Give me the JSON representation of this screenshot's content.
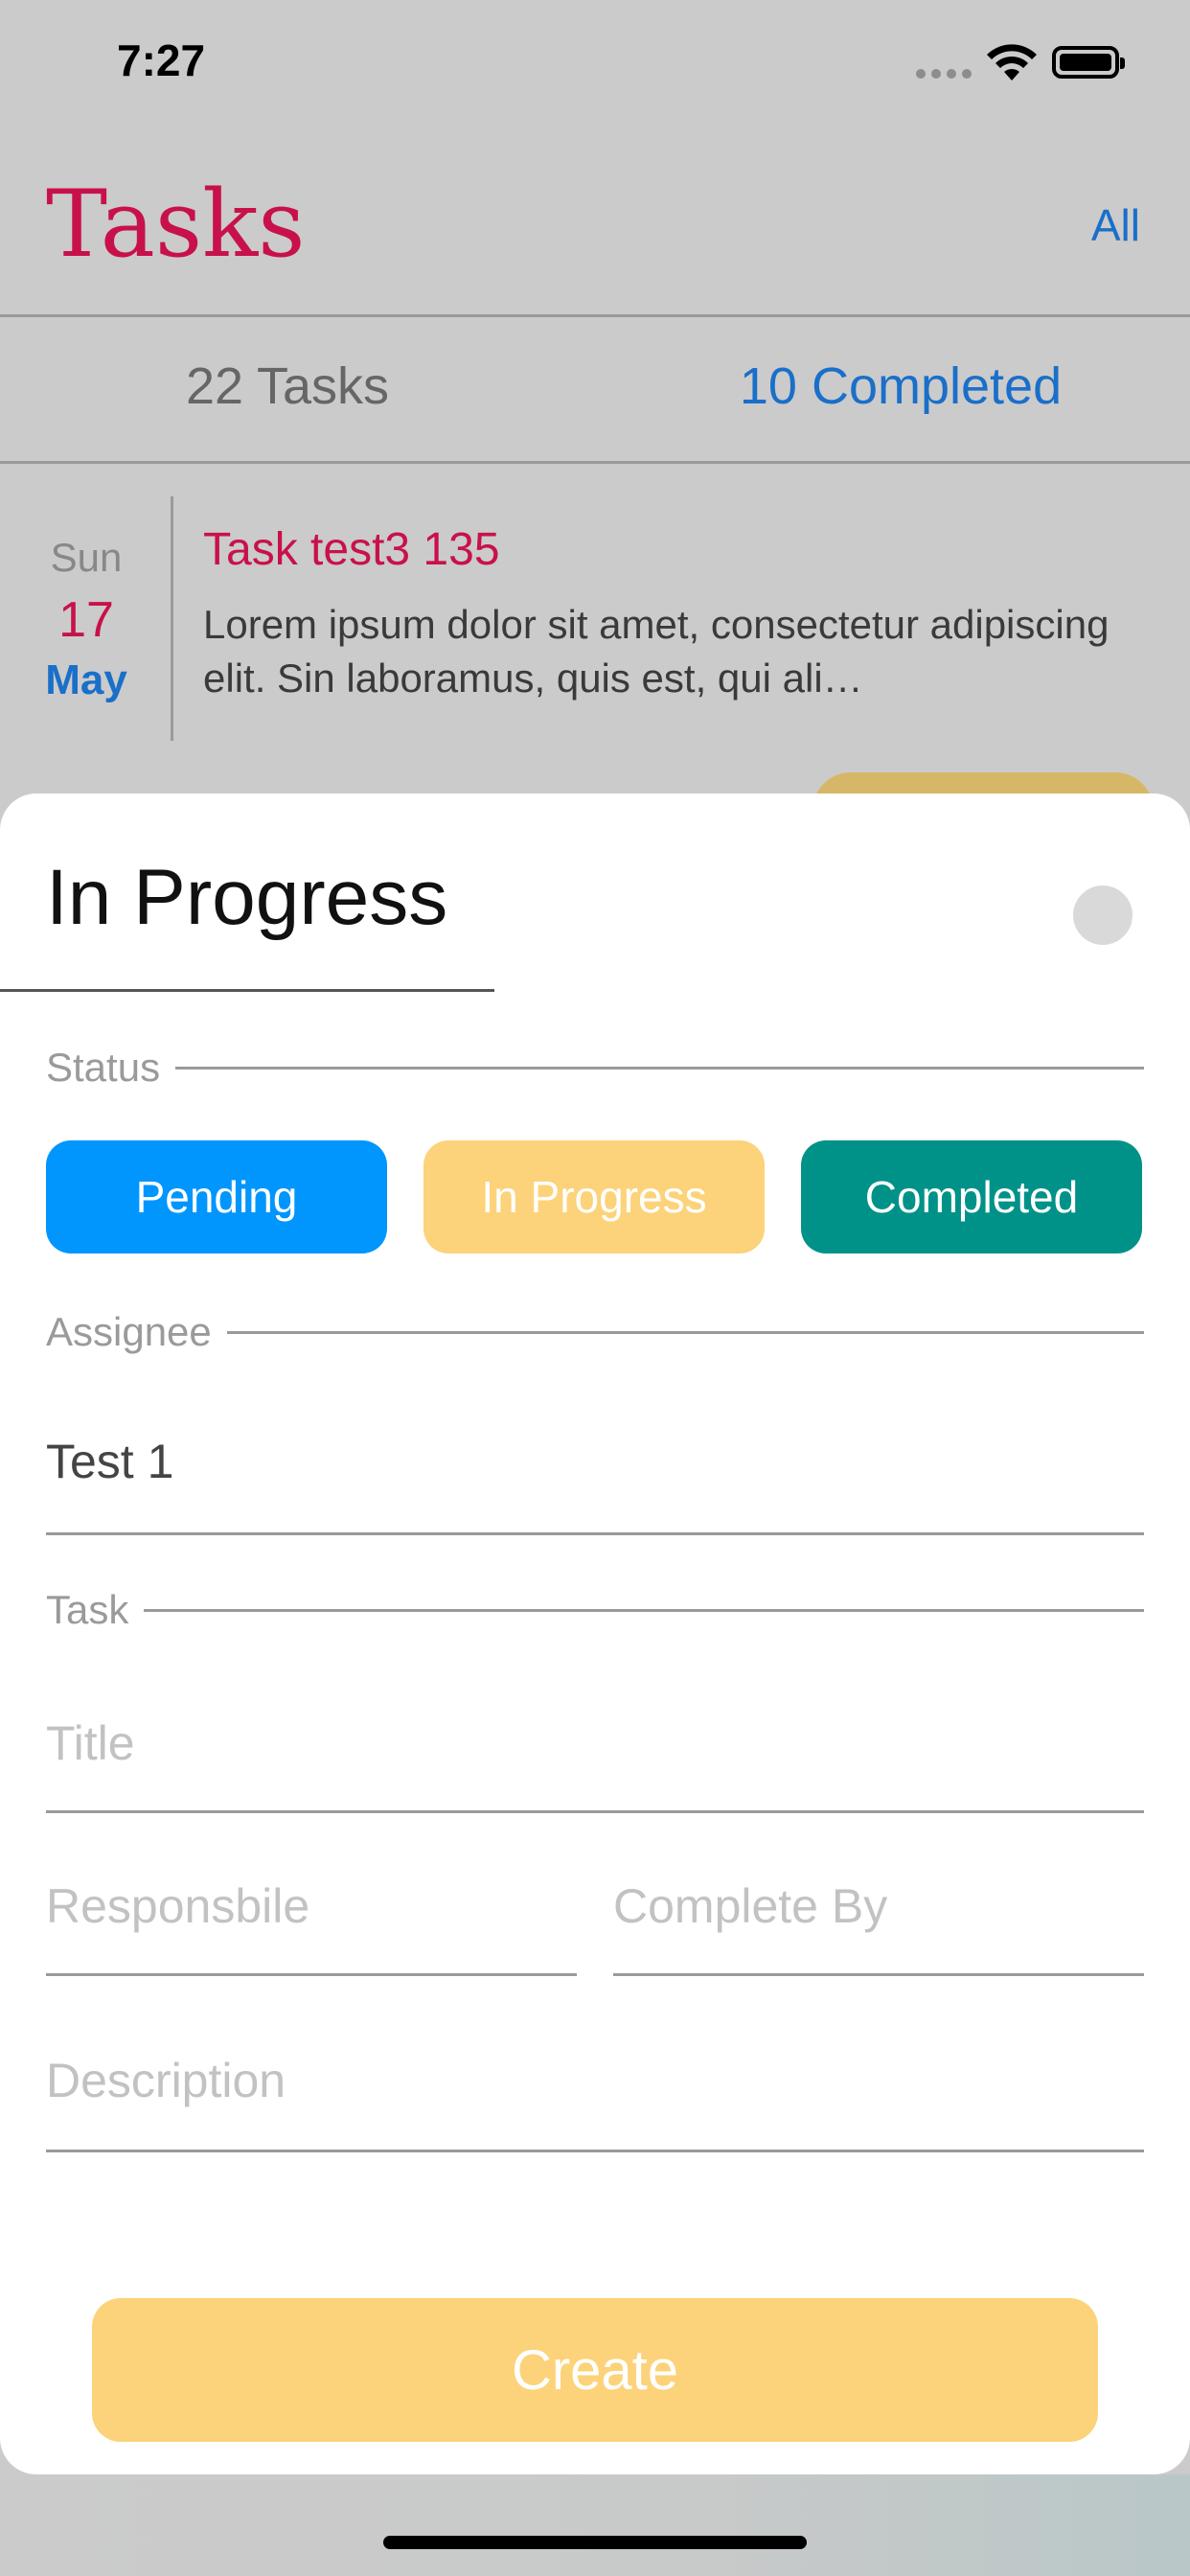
{
  "status_bar": {
    "time": "7:27"
  },
  "header": {
    "title": "Tasks",
    "filter_label": "All"
  },
  "summary": {
    "total": "22 Tasks",
    "completed": "10 Completed"
  },
  "task": {
    "day": "Sun",
    "date": "17",
    "month": "May",
    "title": "Task test3 135",
    "description": "Lorem ipsum dolor sit amet, consectetur adipiscing elit. Sin laboramus, quis est, qui ali…"
  },
  "sheet": {
    "title": "In Progress",
    "status_label": "Status",
    "status_options": [
      "Pending",
      "In Progress",
      "Completed"
    ],
    "assignee_label": "Assignee",
    "assignee_value": "Test 1",
    "task_label": "Task",
    "title_placeholder": "Title",
    "responsible_placeholder": "Responsbile",
    "complete_by_placeholder": "Complete By",
    "description_placeholder": "Description",
    "create_label": "Create"
  },
  "colors": {
    "accent_red": "#c8114a",
    "accent_blue": "#1a6fc9",
    "pending": "#0096fe",
    "in_progress": "#fcd37a",
    "completed": "#009288"
  }
}
